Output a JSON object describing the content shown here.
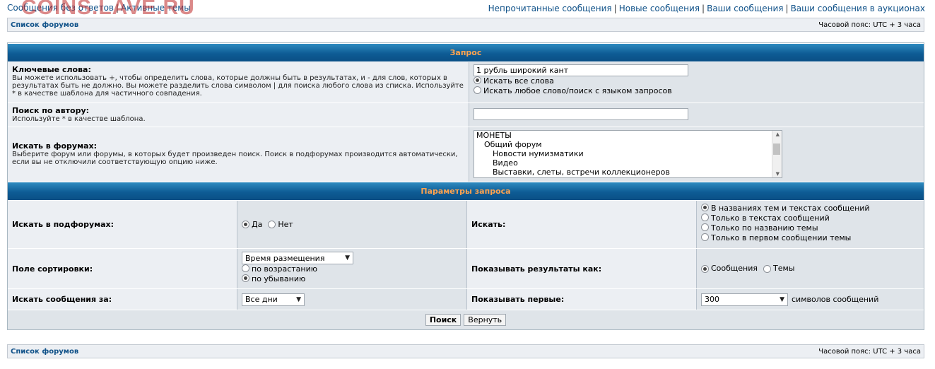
{
  "top": {
    "left_links": [
      "Сообщения без ответов",
      "Активные темы"
    ],
    "watermark": "COINS.LAVE.RU",
    "right_links": [
      "Непрочитанные сообщения",
      "Новые сообщения",
      "Ваши сообщения",
      "Ваши сообщения в аукционах"
    ]
  },
  "navbar": {
    "forums_link": "Список форумов",
    "timezone": "Часовой пояс: UTC + 3 часа"
  },
  "query": {
    "header": "Запрос",
    "keywords": {
      "label": "Ключевые слова:",
      "desc": "Вы можете использовать +, чтобы определить слова, которые должны быть в результатах, и - для слов, которых в результатах быть не должно. Вы можете разделить слова символом | для поиска любого слова из списка. Используйте * в качестве шаблона для частичного совпадения.",
      "value": "1 рубль широкий кант",
      "opt_all": "Искать все слова",
      "opt_any": "Искать любое слово/поиск с языком запросов"
    },
    "author": {
      "label": "Поиск по автору:",
      "desc": "Используйте * в качестве шаблона.",
      "value": ""
    },
    "forums": {
      "label": "Искать в форумах:",
      "desc": "Выберите форум или форумы, в которых будет произведен поиск. Поиск в подфорумах производится автоматически, если вы не отключили соответствующую опцию ниже.",
      "items": [
        "МОНЕТЫ",
        "Общий форум",
        "Новости нумизматики",
        "Видео",
        "Выставки, слеты, встречи коллекционеров"
      ]
    }
  },
  "params": {
    "header": "Параметры запроса",
    "subforums": {
      "label": "Искать в подфорумах:",
      "yes": "Да",
      "no": "Нет"
    },
    "search_in": {
      "label": "Искать:",
      "options": [
        "В названиях тем и текстах сообщений",
        "Только в текстах сообщений",
        "Только по названию темы",
        "Только в первом сообщении темы"
      ]
    },
    "sort": {
      "label": "Поле сортировки:",
      "selected": "Время размещения",
      "asc": "по возрастанию",
      "desc": "по убыванию"
    },
    "show_as": {
      "label": "Показывать результаты как:",
      "posts": "Сообщения",
      "topics": "Темы"
    },
    "period": {
      "label": "Искать сообщения за:",
      "selected": "Все дни"
    },
    "show_first": {
      "label": "Показывать первые:",
      "selected": "300",
      "suffix": "символов сообщений"
    }
  },
  "buttons": {
    "search": "Поиск",
    "reset": "Вернуть"
  }
}
